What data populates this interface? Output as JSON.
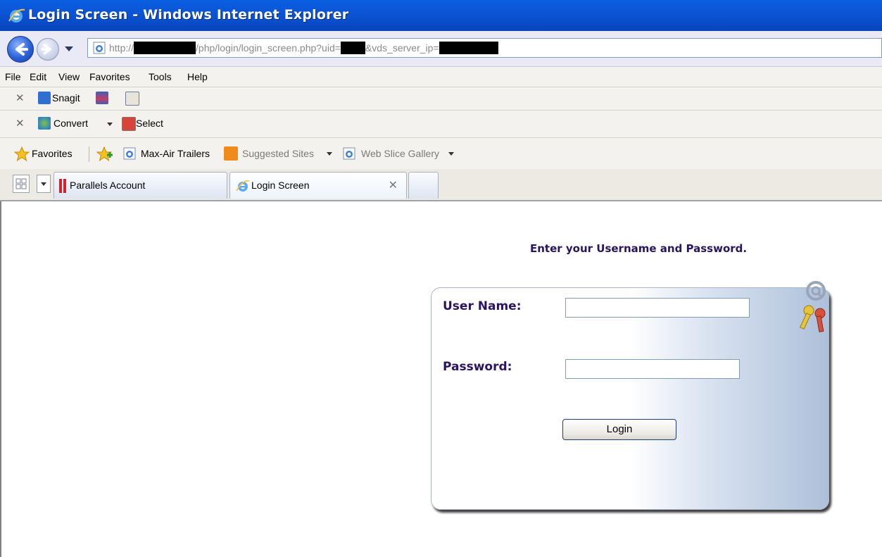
{
  "window": {
    "title": "Login Screen - Windows Internet Explorer"
  },
  "address": {
    "url_parts": [
      "http://",
      "/php/login/login_screen.php?uid=",
      "&vds_server_ip="
    ]
  },
  "menu": [
    "File",
    "Edit",
    "View",
    "Favorites",
    "Tools",
    "Help"
  ],
  "toolbar1": {
    "snagit_label": "Snagit"
  },
  "toolbar2": {
    "convert_label": "Convert",
    "select_label": "Select"
  },
  "favorites": {
    "label": "Favorites",
    "items": [
      "Max-Air Trailers",
      "Suggested Sites",
      "Web Slice Gallery"
    ]
  },
  "tabs": [
    "Parallels Account",
    "Login Screen"
  ],
  "page": {
    "heading": "Enter your Username and Password.",
    "username_label": "User Name:",
    "password_label": "Password:",
    "username_value": "",
    "password_value": "",
    "login_label": "Login"
  }
}
